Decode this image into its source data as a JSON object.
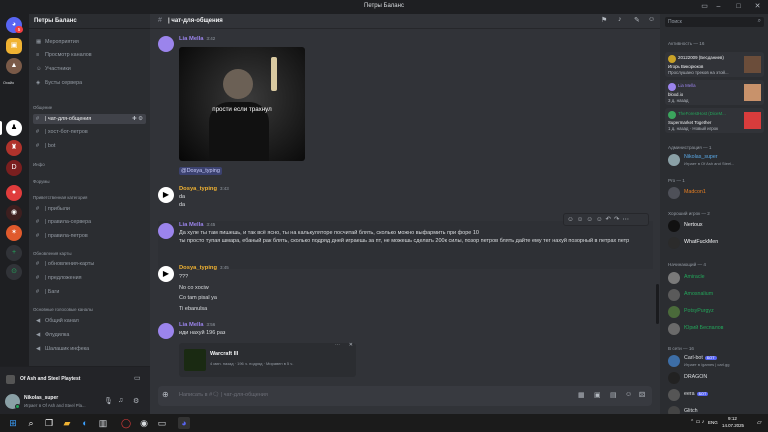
{
  "window": {
    "title": "Петры Баланс"
  },
  "servers": {
    "home_badge": "5",
    "label_ohaio": "Охайо"
  },
  "sidebar": {
    "server_name": "Петры Баланс",
    "top_items": [
      {
        "label": "Мероприятия"
      },
      {
        "label": "Просмотр каналов"
      },
      {
        "label": "Участники"
      },
      {
        "label": "Бусты сервера"
      }
    ],
    "cat_general": "Общение",
    "general": [
      {
        "label": "| чат-для-общения"
      },
      {
        "label": "| хост-бот-петров"
      },
      {
        "label": "| bot"
      }
    ],
    "cat_info": "Инфо",
    "cat_forums": "Форумы",
    "cat_priv": "Приветственная категория",
    "priv": [
      {
        "label": "| прибыли"
      },
      {
        "label": "| правила-сервера"
      },
      {
        "label": "| правила-петров"
      }
    ],
    "cat_updates": "Обновления карты",
    "updates": [
      {
        "label": "| обновления-карты"
      },
      {
        "label": "| предложения"
      },
      {
        "label": "| Баги"
      }
    ],
    "cat_voice": "Основные голосовые каналы",
    "voice": [
      {
        "label": "Общий канал"
      },
      {
        "label": "Флудилка"
      },
      {
        "label": "Шалашик инфека"
      }
    ]
  },
  "voicebar": {
    "title": "Of Ash and Steel Playtest"
  },
  "user": {
    "name": "Nikolas_super",
    "status": "Играет в Of Ash and Steel Pla..."
  },
  "channel": {
    "name": "| чат-для-общения"
  },
  "messages": [
    {
      "author": "Lia Mella",
      "time": "3:42",
      "image_caption": "прости если трахнул",
      "mention": "@Dosya_typing"
    },
    {
      "author": "Dosya_typing",
      "time": "3:43",
      "lines": [
        "da",
        "da"
      ]
    },
    {
      "author": "Lia Mella",
      "time": "3:45",
      "lines": [
        "Да хуле ты там пишешь, и так всё ясно, ты на калькуляторе посчитай блять, сколько можно выфармить при форе 10",
        "ты просто тупая шмара, ебаный рак блять, сколько подряд дней играешь за пт, не можешь сделать 200к силы, позор петров блять дайте ему тег нахуй позорный в петрах петр"
      ]
    },
    {
      "author": "Dosya_typing",
      "time": "3:45",
      "lines": [
        "???",
        "No со xociw",
        "Co tam pisal ya",
        "Ti ebanulsa"
      ]
    },
    {
      "author": "Lia Mella",
      "time": "3:56",
      "lines": [
        "иди нахуй 196 раз"
      ],
      "embed": {
        "title": "Warcraft III",
        "meta": "4 мин. назад · 196 ч. подряд · Миравен в 5 ч."
      }
    }
  ],
  "composer": {
    "placeholder": "Написать в #🗨 | чат-для-общения"
  },
  "members": {
    "search_placeholder": "Поиск",
    "activity_label": "Активность — 16",
    "cards": [
      {
        "name": "20122009 (Бесданиев)",
        "line1": "Игорь Викорюков",
        "line2": "Прослушано треков на этой..."
      },
      {
        "name": "Lia Mella",
        "line1": "bloxd.io",
        "line2": "3 д. назад"
      },
      {
        "name": "TheForestHost (DiceM...",
        "line1": "Supermarket Together",
        "line2": "1 д. назад · Новый игрок"
      }
    ],
    "admin_label": "Администрация — 1",
    "admin": [
      {
        "name": "Nikolas_super",
        "status": "Играет в Of Ash and Steel..."
      }
    ],
    "pro_label": "Pro — 1",
    "pro": [
      {
        "name": "Madcon1"
      }
    ],
    "good_label": "Хороший игрок — 2",
    "good": [
      {
        "name": "Nertoux"
      },
      {
        "name": "WhatFuckMen"
      }
    ],
    "beginner_label": "Начинающий — 4",
    "beginner": [
      {
        "name": "Amiracle"
      },
      {
        "name": "Amosnalium"
      },
      {
        "name": "PotsyPurgyz"
      },
      {
        "name": "Юрий Беспалов"
      }
    ],
    "online_label": "В сети — 16",
    "online": [
      {
        "name": "Carl-bot",
        "badge": "БОТ",
        "status": "Играет в /games | carl.gg"
      },
      {
        "name": "DRAGON"
      },
      {
        "name": "eera",
        "badge": "БОТ"
      },
      {
        "name": "Glitch"
      }
    ]
  },
  "taskbar": {
    "lang": "ENG",
    "time": "9:12",
    "date": "14.07.2025"
  }
}
